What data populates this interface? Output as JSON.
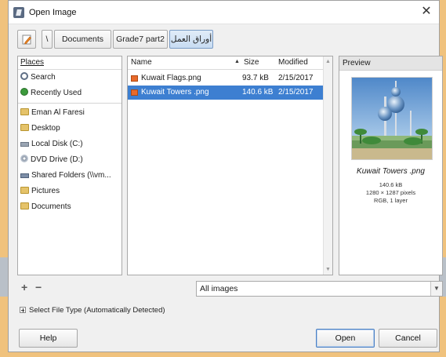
{
  "window": {
    "title": "Open Image",
    "close_glyph": "✕"
  },
  "path": {
    "crumbs": [
      "\\",
      "Documents",
      "Grade7 part2",
      "أوراق العمل"
    ],
    "active_index": 3
  },
  "places": {
    "header": "Places",
    "items": [
      {
        "label": "Search",
        "icon": "search-icon"
      },
      {
        "label": "Recently Used",
        "icon": "recent-icon"
      },
      {
        "label": "Eman Al Faresi",
        "icon": "folder-icon"
      },
      {
        "label": "Desktop",
        "icon": "folder-icon"
      },
      {
        "label": "Local Disk (C:)",
        "icon": "disk-icon"
      },
      {
        "label": "DVD Drive (D:)",
        "icon": "dvd-icon"
      },
      {
        "label": "Shared Folders (\\\\vm...",
        "icon": "network-drive-icon"
      },
      {
        "label": "Pictures",
        "icon": "folder-icon"
      },
      {
        "label": "Documents",
        "icon": "folder-icon"
      }
    ],
    "add_glyph": "+",
    "remove_glyph": "−"
  },
  "files": {
    "columns": {
      "name": "Name",
      "size": "Size",
      "modified": "Modified"
    },
    "sort_glyph": "▲",
    "rows": [
      {
        "name": "Kuwait Flags.png",
        "size": "93.7 kB",
        "modified": "2/15/2017",
        "selected": false
      },
      {
        "name": "Kuwait Towers .png",
        "size": "140.6 kB",
        "modified": "2/15/2017",
        "selected": true
      }
    ]
  },
  "preview": {
    "header": "Preview",
    "name": "Kuwait Towers .png",
    "size": "140.6 kB",
    "dimensions": "1280 × 1287 pixels",
    "info": "RGB, 1 layer"
  },
  "filter": {
    "selected": "All images"
  },
  "file_type": {
    "label": "Select File Type (Automatically Detected)"
  },
  "buttons": {
    "help": "Help",
    "open": "Open",
    "cancel": "Cancel"
  },
  "colors": {
    "selection": "#3d7fd1",
    "background_frame": "#f3cd8e"
  }
}
